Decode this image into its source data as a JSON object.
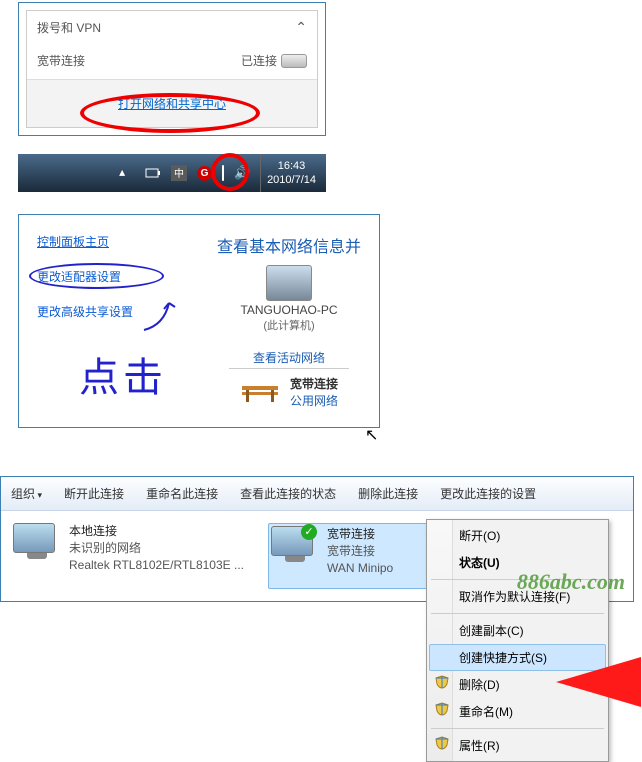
{
  "popup": {
    "section_title": "拨号和 VPN",
    "item_name": "宽带连接",
    "item_status": "已连接",
    "footer_link": "打开网络和共享中心"
  },
  "taskbar": {
    "time": "16:43",
    "date": "2010/7/14",
    "icons": {
      "up_arrow": "tray-up-arrow",
      "power": "tray-power-icon",
      "ime": "tray-ime-icon",
      "g_badge": "G",
      "network": "tray-network-icon",
      "volume": "tray-volume-icon"
    }
  },
  "netcenter": {
    "left": {
      "control_panel": "控制面板主页",
      "adapter_settings": "更改适配器设置",
      "advanced_sharing": "更改高级共享设置",
      "handwriting": "点击"
    },
    "right": {
      "title": "查看基本网络信息并",
      "pc_name": "TANGUOHAO-PC",
      "pc_desc": "(此计算机)",
      "section": "查看活动网络",
      "net_name": "宽带连接",
      "net_type": "公用网络"
    }
  },
  "connwin": {
    "toolbar": {
      "organize": "组织",
      "disconnect": "断开此连接",
      "rename": "重命名此连接",
      "status": "查看此连接的状态",
      "delete_": "删除此连接",
      "change": "更改此连接的设置"
    },
    "items": [
      {
        "name": "本地连接",
        "line2": "未识别的网络",
        "line3": "Realtek RTL8102E/RTL8103E ..."
      },
      {
        "name": "宽带连接",
        "line2": "宽带连接",
        "line3": "WAN Minipo"
      }
    ],
    "context_menu": {
      "disconnect": "断开(O)",
      "status": "状态(U)",
      "unset_default": "取消作为默认连接(F)",
      "create_copy": "创建副本(C)",
      "create_shortcut": "创建快捷方式(S)",
      "delete_": "删除(D)",
      "rename": "重命名(M)",
      "properties": "属性(R)"
    }
  },
  "watermark": "886abc.com"
}
